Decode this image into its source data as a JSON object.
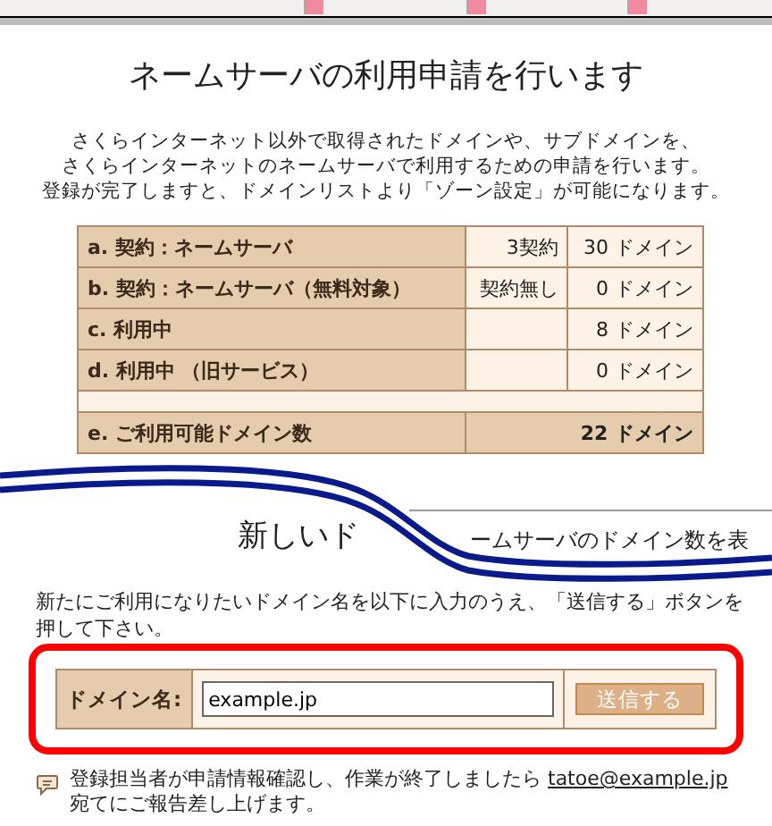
{
  "title": "ネームサーバの利用申請を行います",
  "intro": [
    "さくらインターネット以外で取得されたドメインや、サブドメインを、",
    "さくらインターネットのネームサーバで利用するための申請を行います。",
    "登録が完了しますと、ドメインリストより「ゾーン設定」が可能になります。"
  ],
  "summary": {
    "rows": [
      {
        "kind": "item",
        "label": "a. 契約：ネームサーバ",
        "contracts": "3契約",
        "domains": "30 ドメイン"
      },
      {
        "kind": "item",
        "label": "b. 契約：ネームサーバ（無料対象）",
        "contracts": "契約無し",
        "domains": "0 ドメイン"
      },
      {
        "kind": "item",
        "label": "c. 利用中",
        "domains": "8 ドメイン"
      },
      {
        "kind": "item",
        "label": "d. 利用中 （旧サービス）",
        "domains": "0 ドメイン"
      },
      {
        "kind": "spacer"
      },
      {
        "kind": "total",
        "label": "e. ご利用可能ドメイン数",
        "domains": "22 ドメイン"
      }
    ]
  },
  "section_heading": [
    "新しいド",
    "ームサーバのドメイン数を表"
  ],
  "instruction": "新たにご利用になりたいドメイン名を以下に入力のうえ、「送信する」ボタンを押して下さい。",
  "form": {
    "label": "ドメイン名:",
    "value": "example.jp",
    "button": "送信する"
  },
  "note": {
    "text": "登録担当者が申請情報確認し、作業が終了しましたら ",
    "link": "tatoe@example.jp",
    "after": "宛てにご報告差し上げます。"
  }
}
